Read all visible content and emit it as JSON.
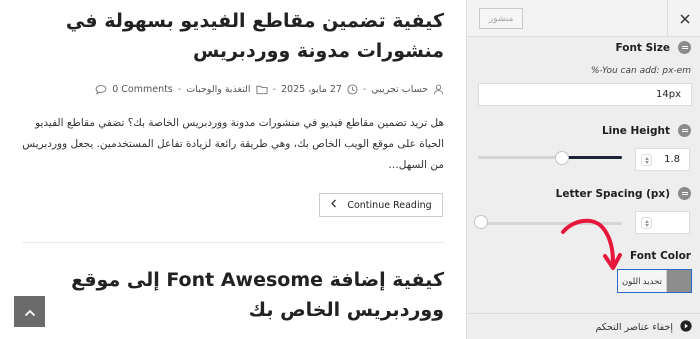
{
  "preview": {
    "post1": {
      "title": "كيفية تضمين مقاطع الفيديو بسهولة في منشورات مدونة ووردبريس",
      "meta": {
        "author": "حساب تجريبي",
        "date": "27 مايو، 2025",
        "category": "التغذية والوجبات",
        "comments": "0 Comments"
      },
      "excerpt": "هل تريد تضمين مقاطع فيديو في منشورات مدونة ووردبريس الخاصة بك؟ تضفي مقاطع الفيديو الحياة على موقع الويب الخاص بك، وهي طريقة رائعة لزيادة تفاعل المستخدمين. يجعل ووردبريس من السهل…",
      "read_more": "Continue Reading"
    },
    "post2": {
      "title": "كيفية إضافة Font Awesome إلى موقع ووردبريس الخاص بك"
    }
  },
  "customizer": {
    "publish_label": "منشور",
    "font_size": {
      "label": "Font Size",
      "hint": "%-You can add: px-em",
      "value": "14px"
    },
    "line_height": {
      "label": "Line Height",
      "value": "1.8",
      "slider_fraction": 0.58
    },
    "letter_spacing": {
      "label": "Letter Spacing (px)",
      "value": "",
      "slider_fraction": 0.0
    },
    "font_color": {
      "label": "Font Color",
      "button_label": "تحديد اللون",
      "swatch": "#8d8d8d"
    },
    "hide_controls": "إخفاء عناصر التحكم"
  },
  "colors": {
    "accent": "#2d68c9",
    "slider_fill": "#1d2336",
    "annotation_arrow": "#e8173c",
    "scroll_top_bg": "#6b6b6b"
  },
  "icons": [
    "user-icon",
    "clock-icon",
    "folder-icon",
    "comment-icon",
    "chevron-left-icon",
    "chevron-up-icon",
    "close-icon",
    "help-icon",
    "play-circle-icon",
    "red-arrow-annotation"
  ]
}
